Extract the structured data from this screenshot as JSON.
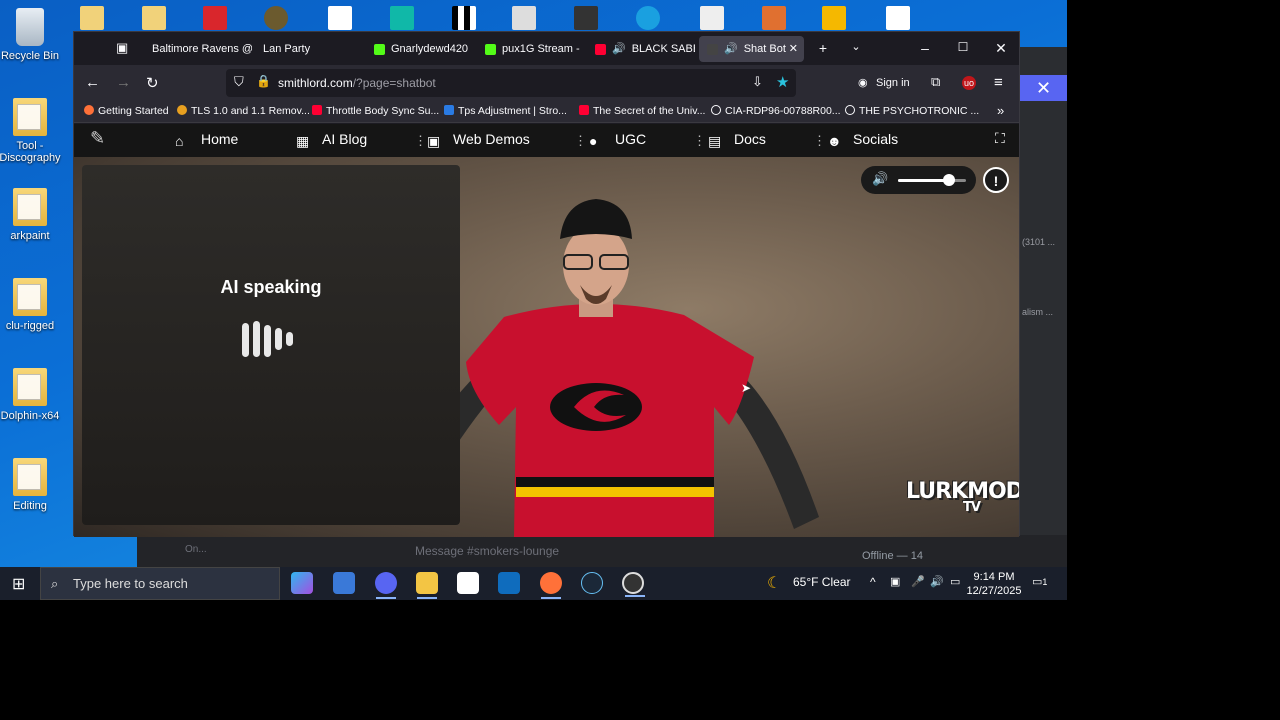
{
  "desktop": {
    "icons": [
      {
        "label": "Recycle Bin"
      },
      {
        "label": "Tool - Discography"
      },
      {
        "label": "arkpaint"
      },
      {
        "label": "clu-rigged"
      },
      {
        "label": "Dolphin-x64"
      },
      {
        "label": "Editing"
      }
    ]
  },
  "browser": {
    "tabs": [
      {
        "label": "Baltimore Ravens @"
      },
      {
        "label": "Lan Party"
      },
      {
        "label": "Gnarlydewd420"
      },
      {
        "label": "pux1G Stream -"
      },
      {
        "label": "BLACK SABB"
      },
      {
        "label": "Shat Bot"
      }
    ],
    "url_host": "smithlord.com",
    "url_path": "/?page=shatbot",
    "sign_in": "Sign in",
    "bookmarks": [
      {
        "label": "Getting Started"
      },
      {
        "label": "TLS 1.0 and 1.1 Remov..."
      },
      {
        "label": "Throttle Body Sync Su..."
      },
      {
        "label": "Tps Adjustment | Stro..."
      },
      {
        "label": "The Secret of the Univ..."
      },
      {
        "label": "CIA-RDP96-00788R00..."
      },
      {
        "label": "THE PSYCHOTRONIC ..."
      }
    ]
  },
  "site": {
    "nav": [
      {
        "label": "Home"
      },
      {
        "label": "AI Blog"
      },
      {
        "label": "Web Demos"
      },
      {
        "label": "UGC"
      },
      {
        "label": "Docs"
      },
      {
        "label": "Socials"
      }
    ],
    "status": "AI speaking",
    "volume": 0.75,
    "logo": "LURKMODE",
    "logo_sub": "TV"
  },
  "background_app": {
    "count_text": "(3101 ...",
    "side_text": "alism ...",
    "message_placeholder": "Message #smokers-lounge",
    "user_status": "On...",
    "offline": "Offline — 14"
  },
  "taskbar": {
    "search_placeholder": "Type here to search",
    "weather": "65°F  Clear",
    "time": "9:14 PM",
    "date": "12/27/2025",
    "notifications": "1"
  }
}
